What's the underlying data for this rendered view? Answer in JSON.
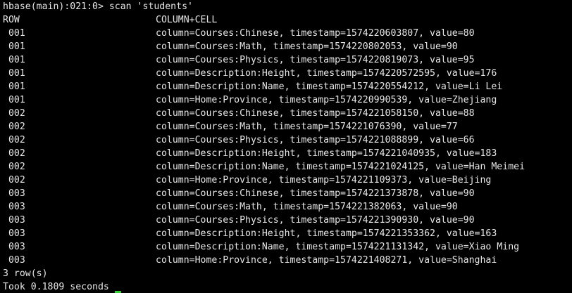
{
  "terminal": {
    "prompt": "hbase(main):021:0> scan 'students'",
    "header": {
      "row": "ROW",
      "cell": "COLUMN+CELL"
    },
    "rows": [
      {
        "key": " 001",
        "cell": "column=Courses:Chinese, timestamp=1574220603807, value=80"
      },
      {
        "key": " 001",
        "cell": "column=Courses:Math, timestamp=1574220802053, value=90"
      },
      {
        "key": " 001",
        "cell": "column=Courses:Physics, timestamp=1574220819073, value=95"
      },
      {
        "key": " 001",
        "cell": "column=Description:Height, timestamp=1574220572595, value=176"
      },
      {
        "key": " 001",
        "cell": "column=Description:Name, timestamp=1574220554212, value=Li Lei"
      },
      {
        "key": " 001",
        "cell": "column=Home:Province, timestamp=1574220990539, value=Zhejiang"
      },
      {
        "key": " 002",
        "cell": "column=Courses:Chinese, timestamp=1574221058150, value=88"
      },
      {
        "key": " 002",
        "cell": "column=Courses:Math, timestamp=1574221076390, value=77"
      },
      {
        "key": " 002",
        "cell": "column=Courses:Physics, timestamp=1574221088899, value=66"
      },
      {
        "key": " 002",
        "cell": "column=Description:Height, timestamp=1574221040935, value=183"
      },
      {
        "key": " 002",
        "cell": "column=Description:Name, timestamp=1574221024125, value=Han Meimei"
      },
      {
        "key": " 002",
        "cell": "column=Home:Province, timestamp=1574221109373, value=Beijing"
      },
      {
        "key": " 003",
        "cell": "column=Courses:Chinese, timestamp=1574221373878, value=90"
      },
      {
        "key": " 003",
        "cell": "column=Courses:Math, timestamp=1574221382063, value=90"
      },
      {
        "key": " 003",
        "cell": "column=Courses:Physics, timestamp=1574221390930, value=90"
      },
      {
        "key": " 003",
        "cell": "column=Description:Height, timestamp=1574221353362, value=163"
      },
      {
        "key": " 003",
        "cell": "column=Description:Name, timestamp=1574221131342, value=Xiao Ming"
      },
      {
        "key": " 003",
        "cell": "column=Home:Province, timestamp=1574221408271, value=Shanghai"
      }
    ],
    "summary": "3 row(s)",
    "timing": "Took 0.1809 seconds",
    "colors": {
      "background": "#000000",
      "text": "#e6e6e6",
      "cursor": "#33cc33"
    }
  }
}
